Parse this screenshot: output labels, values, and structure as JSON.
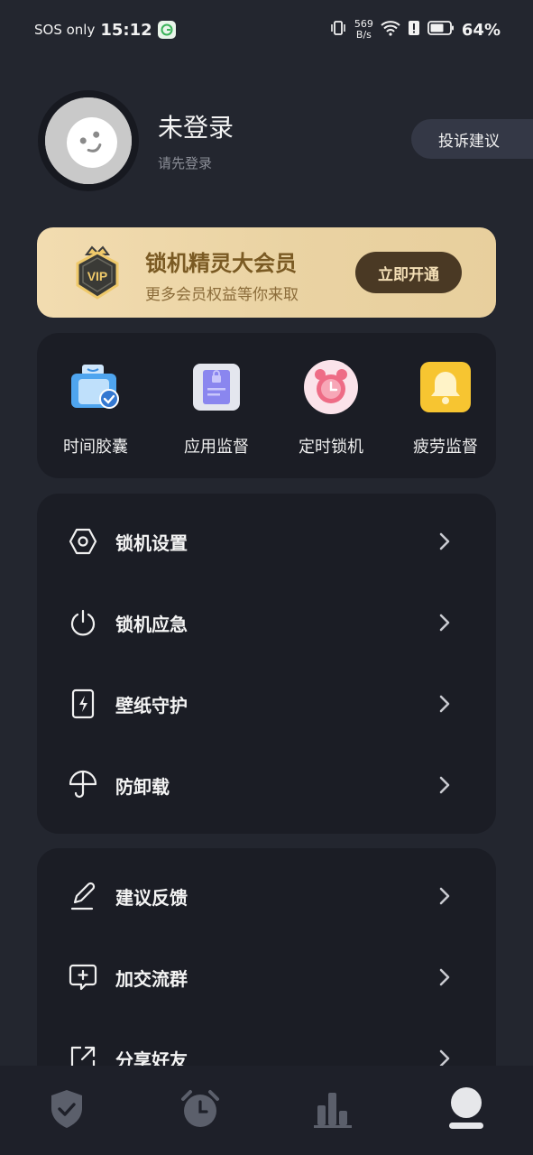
{
  "status_bar": {
    "carrier": "SOS only",
    "time": "15:12",
    "net_speed_value": "569",
    "net_speed_unit": "B/s",
    "battery_percent": "64%"
  },
  "profile": {
    "username": "未登录",
    "login_hint": "请先登录",
    "feedback_button": "投诉建议"
  },
  "vip": {
    "badge_text": "VIP",
    "title": "锁机精灵大会员",
    "subtitle": "更多会员权益等你来取",
    "button": "立即开通"
  },
  "quick_actions": [
    {
      "label": "时间胶囊",
      "icon": "time-capsule-icon"
    },
    {
      "label": "应用监督",
      "icon": "app-monitor-icon"
    },
    {
      "label": "定时锁机",
      "icon": "alarm-clock-icon"
    },
    {
      "label": "疲劳监督",
      "icon": "bell-icon"
    }
  ],
  "settings_menu": [
    {
      "label": "锁机设置",
      "icon": "hexagon-settings-icon"
    },
    {
      "label": "锁机应急",
      "icon": "power-icon"
    },
    {
      "label": "壁纸守护",
      "icon": "phone-charge-icon"
    },
    {
      "label": "防卸载",
      "icon": "umbrella-icon"
    }
  ],
  "social_menu": [
    {
      "label": "建议反馈",
      "icon": "edit-pen-icon"
    },
    {
      "label": "加交流群",
      "icon": "chat-add-icon"
    },
    {
      "label": "分享好友",
      "icon": "share-icon"
    }
  ],
  "tabs": [
    {
      "icon": "shield-check-icon",
      "active": false
    },
    {
      "icon": "alarm-clock-tab-icon",
      "active": false
    },
    {
      "icon": "bar-chart-icon",
      "active": false
    },
    {
      "icon": "user-profile-icon",
      "active": true
    }
  ],
  "colors": {
    "background": "#23262f",
    "card": "#1b1d25",
    "vip_gold": "#7a5a23",
    "tab_inactive": "#5b5f6b",
    "tab_active": "#e6e7ea"
  }
}
